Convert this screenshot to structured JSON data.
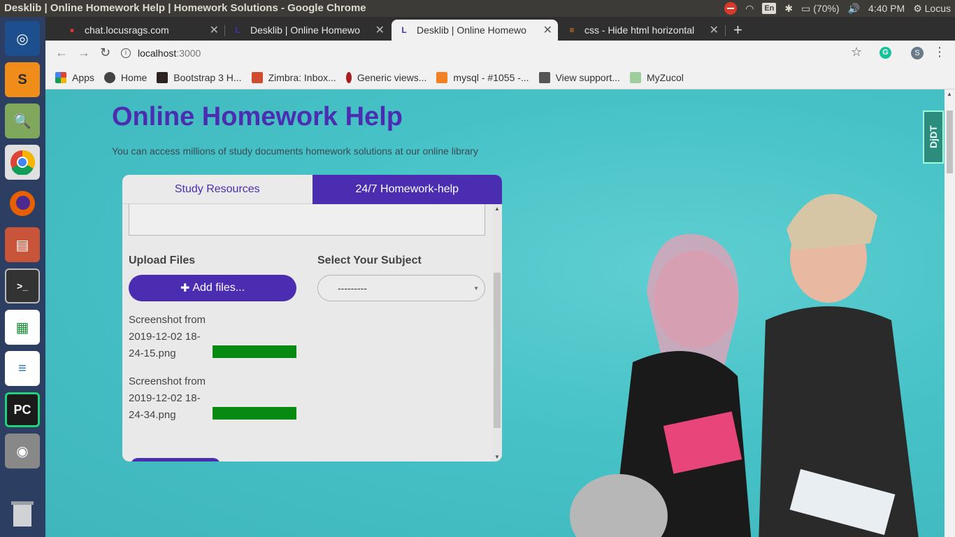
{
  "window_title": "Desklib | Online Homework Help | Homework Solutions - Google Chrome",
  "system": {
    "lang": "En",
    "battery": "(70%)",
    "clock": "4:40 PM",
    "user": "Locus"
  },
  "tabs": [
    {
      "title": "chat.locusrags.com",
      "active": false
    },
    {
      "title": "Desklib | Online Homewo",
      "active": false
    },
    {
      "title": "Desklib | Online Homewo",
      "active": true
    },
    {
      "title": "css - Hide html horizontal",
      "active": false
    }
  ],
  "address": {
    "host": "localhost",
    "port": ":3000"
  },
  "profile_initial": "S",
  "bookmarks": [
    "Apps",
    "Home",
    "Bootstrap 3 H...",
    "Zimbra: Inbox...",
    "Generic views...",
    "mysql - #1055 -...",
    "View support...",
    "MyZucol"
  ],
  "page": {
    "title": "Online Homework Help",
    "subtitle": "You can access millions of study documents homework solutions at our online library",
    "tab_study": "Study Resources",
    "tab_homework": "24/7 Homework-help",
    "upload_label": "Upload Files",
    "subject_label": "Select Your Subject",
    "add_files": "Add files...",
    "subject_selected": "---------",
    "files": [
      {
        "name": "Screenshot from 2019-12-02 18-24-15.png",
        "progress": 1.0
      },
      {
        "name": "Screenshot from 2019-12-02 18-24-34.png",
        "progress": 1.0
      }
    ],
    "ddt_badge": "DjDT"
  },
  "colors": {
    "brand_purple": "#4b2db2",
    "progress_green": "#068a12",
    "teal_bg": "#46c2c6"
  }
}
